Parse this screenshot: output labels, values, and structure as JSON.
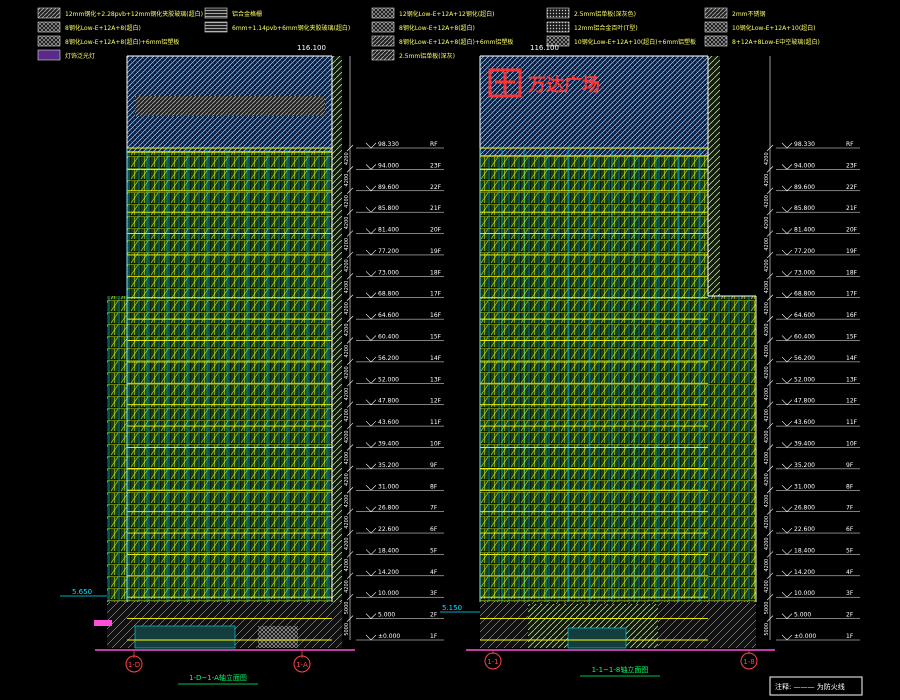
{
  "legend": [
    {
      "code": "L1",
      "label": "12mm钢化+2.28pvb+12mm钢化夹胶玻璃(超白)"
    },
    {
      "code": "L2",
      "label": "铝合金格栅"
    },
    {
      "code": "L3",
      "label": "12钢化Low-E+12A+12钢化(超白)"
    },
    {
      "code": "L4",
      "label": "2.5mm铝单板(深灰色)"
    },
    {
      "code": "L5",
      "label": "2mm不锈钢"
    },
    {
      "code": "L6",
      "label": "8钢化Low-E+12A+8(超白)"
    },
    {
      "code": "L7",
      "label": "6mm+1.14pvb+6mm钢化夹胶玻璃(超白)"
    },
    {
      "code": "L8",
      "label": "8钢化Low-E+12A+8(超白)"
    },
    {
      "code": "L9",
      "label": "12mm铝合金百叶(T型)"
    },
    {
      "code": "L10",
      "label": "10钢化Low-E+12A+10(超白)"
    },
    {
      "code": "L11",
      "label": "8钢化Low-E+12A+8(超白)+6mm铝塑板"
    },
    {
      "code": "L12",
      "label": "8钢化Low-E+12A+8(超白)+6mm铝塑板"
    },
    {
      "code": "L13",
      "label": "10钢化Low-E+12A+10(超白)+6mm铝塑板"
    },
    {
      "code": "L14",
      "label": "8+12A+8Low-E中空玻璃(超白)"
    },
    {
      "code": "L15",
      "label": "2.5mm铝单板(深灰)"
    },
    {
      "code": "L16",
      "label": "灯饰泛光灯"
    }
  ],
  "logo_text": "万达广场",
  "top_elev_label": "116.100",
  "ground_elev_left": "5.650",
  "ground_elev_right": "5.150",
  "levels": [
    {
      "elev": "98.330",
      "floor": "RF"
    },
    {
      "elev": "94.000",
      "floor": "23F"
    },
    {
      "elev": "89.600",
      "floor": "22F"
    },
    {
      "elev": "85.800",
      "floor": "21F"
    },
    {
      "elev": "81.400",
      "floor": "20F"
    },
    {
      "elev": "77.200",
      "floor": "19F"
    },
    {
      "elev": "73.000",
      "floor": "18F"
    },
    {
      "elev": "68.800",
      "floor": "17F"
    },
    {
      "elev": "64.600",
      "floor": "16F"
    },
    {
      "elev": "60.400",
      "floor": "15F"
    },
    {
      "elev": "56.200",
      "floor": "14F"
    },
    {
      "elev": "52.000",
      "floor": "13F"
    },
    {
      "elev": "47.800",
      "floor": "12F"
    },
    {
      "elev": "43.600",
      "floor": "11F"
    },
    {
      "elev": "39.400",
      "floor": "10F"
    },
    {
      "elev": "35.200",
      "floor": "9F"
    },
    {
      "elev": "31.000",
      "floor": "8F"
    },
    {
      "elev": "26.800",
      "floor": "7F"
    },
    {
      "elev": "22.600",
      "floor": "6F"
    },
    {
      "elev": "18.400",
      "floor": "5F"
    },
    {
      "elev": "14.200",
      "floor": "4F"
    },
    {
      "elev": "10.000",
      "floor": "3F"
    },
    {
      "elev": "5.000",
      "floor": "2F"
    },
    {
      "elev": "±0.000",
      "floor": "1F"
    }
  ],
  "dims": [
    "4200",
    "4200",
    "4200",
    "4200",
    "4200",
    "4200",
    "4200",
    "4200",
    "4200",
    "4200",
    "4200",
    "4200",
    "4200",
    "4200",
    "4200",
    "4200",
    "4200",
    "4200",
    "4200",
    "4200",
    "4200",
    "5000",
    "5000"
  ],
  "axes": {
    "left_a": "1-D",
    "left_b": "1-A",
    "right_a": "1-1",
    "right_b": "1-8"
  },
  "titles": {
    "left": "1-D~1-A轴立面图",
    "right": "1-1~1-8轴立面图"
  },
  "note": "注释: ——— 为防火线"
}
